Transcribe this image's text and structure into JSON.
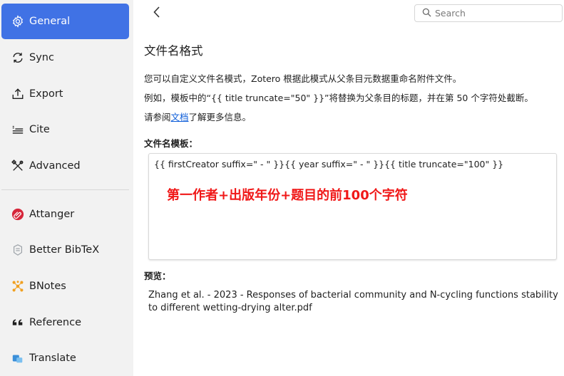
{
  "sidebar": {
    "items": [
      {
        "label": "General",
        "icon": "gear-icon",
        "active": true
      },
      {
        "label": "Sync",
        "icon": "sync-icon"
      },
      {
        "label": "Export",
        "icon": "export-icon"
      },
      {
        "label": "Cite",
        "icon": "cite-icon"
      },
      {
        "label": "Advanced",
        "icon": "advanced-icon"
      },
      {
        "label": "Attanger",
        "icon": "paperclip-icon"
      },
      {
        "label": "Better BibTeX",
        "icon": "bibtex-icon"
      },
      {
        "label": "BNotes",
        "icon": "bnotes-icon"
      },
      {
        "label": "Reference",
        "icon": "quote-icon"
      },
      {
        "label": "Translate",
        "icon": "translate-icon"
      }
    ]
  },
  "search": {
    "placeholder": "Search"
  },
  "main": {
    "title": "文件名格式",
    "desc1": "您可以自定义文件名模式，Zotero 根据此模式从父条目元数据重命名附件文件。",
    "desc2": "例如，模板中的“{{ title truncate=\"50\" }}”将替换为父条目的标题，并在第 50 个字符处截断。",
    "desc3_prefix": "请参阅",
    "desc3_link": "文档",
    "desc3_suffix": "了解更多信息。",
    "template_label": "文件名模板：",
    "template_value": "{{ firstCreator suffix=\" - \" }}{{ year suffix=\" - \" }}{{ title truncate=\"100\" }}",
    "annotation": "第一作者+出版年份+题目的前100个字符",
    "preview_label": "预览：",
    "preview_value": "Zhang et al. - 2023 - Responses of bacterial community and N-cycling functions stability to different wetting-drying alter.pdf"
  },
  "colors": {
    "accent": "#4072e5",
    "annotation": "#f01818",
    "link": "#0a5bd8"
  }
}
